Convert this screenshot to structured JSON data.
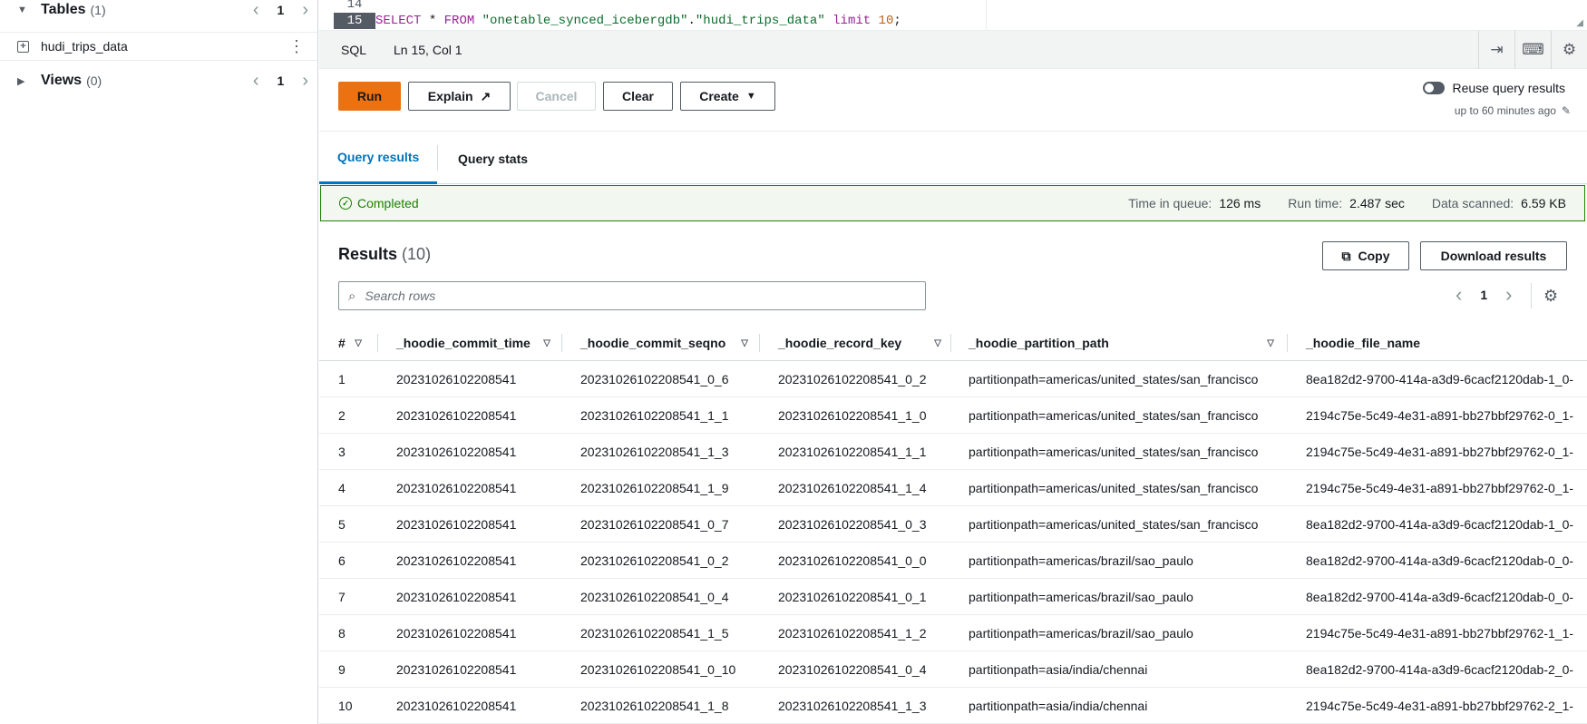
{
  "sidebar": {
    "tables": {
      "label": "Tables",
      "count": "(1)",
      "page": "1"
    },
    "table_item": "hudi_trips_data",
    "views": {
      "label": "Views",
      "count": "(0)",
      "page": "1"
    }
  },
  "editor": {
    "line_14": "14",
    "line_15": "15",
    "code": {
      "kw1": "SELECT",
      "star": " * ",
      "kw2": "FROM",
      "space": " ",
      "db": "\"onetable_synced_icebergdb\"",
      "dot": ".",
      "tbl": "\"hudi_trips_data\"",
      "limit": " limit ",
      "num": "10",
      "semi": ";"
    }
  },
  "statusbar": {
    "language": "SQL",
    "position": "Ln 15, Col 1"
  },
  "toolbar": {
    "run": "Run",
    "explain": "Explain",
    "cancel": "Cancel",
    "clear": "Clear",
    "create": "Create",
    "reuse_label": "Reuse query results",
    "reuse_sub": "up to 60 minutes ago"
  },
  "tabs": {
    "results": "Query results",
    "stats": "Query stats"
  },
  "banner": {
    "status": "Completed",
    "queue_label": "Time in queue:",
    "queue_value": "126 ms",
    "run_label": "Run time:",
    "run_value": "2.487 sec",
    "scanned_label": "Data scanned:",
    "scanned_value": "6.59 KB"
  },
  "results": {
    "title": "Results",
    "count": "(10)",
    "copy": "Copy",
    "download": "Download results",
    "search_placeholder": "Search rows",
    "page": "1"
  },
  "table": {
    "columns": [
      "#",
      "_hoodie_commit_time",
      "_hoodie_commit_seqno",
      "_hoodie_record_key",
      "_hoodie_partition_path",
      "_hoodie_file_name"
    ],
    "rows": [
      [
        "1",
        "20231026102208541",
        "20231026102208541_0_6",
        "20231026102208541_0_2",
        "partitionpath=americas/united_states/san_francisco",
        "8ea182d2-9700-414a-a3d9-6cacf2120dab-1_0-"
      ],
      [
        "2",
        "20231026102208541",
        "20231026102208541_1_1",
        "20231026102208541_1_0",
        "partitionpath=americas/united_states/san_francisco",
        "2194c75e-5c49-4e31-a891-bb27bbf29762-0_1-"
      ],
      [
        "3",
        "20231026102208541",
        "20231026102208541_1_3",
        "20231026102208541_1_1",
        "partitionpath=americas/united_states/san_francisco",
        "2194c75e-5c49-4e31-a891-bb27bbf29762-0_1-"
      ],
      [
        "4",
        "20231026102208541",
        "20231026102208541_1_9",
        "20231026102208541_1_4",
        "partitionpath=americas/united_states/san_francisco",
        "2194c75e-5c49-4e31-a891-bb27bbf29762-0_1-"
      ],
      [
        "5",
        "20231026102208541",
        "20231026102208541_0_7",
        "20231026102208541_0_3",
        "partitionpath=americas/united_states/san_francisco",
        "8ea182d2-9700-414a-a3d9-6cacf2120dab-1_0-"
      ],
      [
        "6",
        "20231026102208541",
        "20231026102208541_0_2",
        "20231026102208541_0_0",
        "partitionpath=americas/brazil/sao_paulo",
        "8ea182d2-9700-414a-a3d9-6cacf2120dab-0_0-"
      ],
      [
        "7",
        "20231026102208541",
        "20231026102208541_0_4",
        "20231026102208541_0_1",
        "partitionpath=americas/brazil/sao_paulo",
        "8ea182d2-9700-414a-a3d9-6cacf2120dab-0_0-"
      ],
      [
        "8",
        "20231026102208541",
        "20231026102208541_1_5",
        "20231026102208541_1_2",
        "partitionpath=americas/brazil/sao_paulo",
        "2194c75e-5c49-4e31-a891-bb27bbf29762-1_1-"
      ],
      [
        "9",
        "20231026102208541",
        "20231026102208541_0_10",
        "20231026102208541_0_4",
        "partitionpath=asia/india/chennai",
        "8ea182d2-9700-414a-a3d9-6cacf2120dab-2_0-"
      ],
      [
        "10",
        "20231026102208541",
        "20231026102208541_1_8",
        "20231026102208541_1_3",
        "partitionpath=asia/india/chennai",
        "2194c75e-5c49-4e31-a891-bb27bbf29762-2_1-"
      ]
    ]
  },
  "colors": {
    "accent": "#0073bb",
    "run": "#ec7211",
    "success": "#1d8102"
  }
}
